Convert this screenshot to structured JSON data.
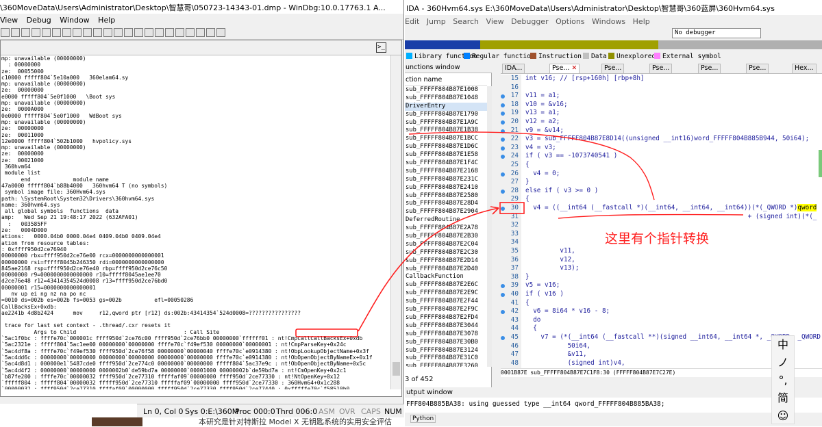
{
  "windbg": {
    "title": "\\360MoveData\\Users\\Administrator\\Desktop\\智慧哥\\050723-14343-01.dmp - WinDbg:10.0.17763.1 A...",
    "menu": [
      "View",
      "Debug",
      "Window",
      "Help"
    ],
    "cmd_icon": ">_",
    "lines": [
      "mp: unavailable (00000000)",
      "  : 00000000",
      "ze:  00055000",
      "c10000 fffff804`5e10a000   360elam64.sy",
      "mp: unavailable (00000000)",
      "ze:  00000000",
      "e0000 fffff804`5e0f1000   \\Boot sys",
      "mp: unavailable (00000000)",
      "ze:  0000A000",
      "0e0000 fffff804`5e0f1000   WdBoot sys",
      "mp: unavailable (00000000)",
      "ze:  00000000",
      "ze:  00011000",
      "12e0000 fffff804`502b1000   hvpolicy.sys",
      "mp: unavailable (00000000)",
      "ze:  00000000",
      "ze:  00021000",
      " 360hvm64",
      " module list",
      "      end             module name",
      "47a0000 fffff804`b88b4000   360hvm64 T (no symbols)",
      " symbol image file: 360Hvm64.sys",
      "path: \\SystemRoot\\System32\\Drivers\\360hvm64.sys",
      "name: 360hvm64.sys",
      " all global symbols  functions  data",
      "amp:   Wed Sep 21 19:48:17 2022 (632AFA01)",
      "  :   003585FF",
      "ze:   0004D000",
      "ations:   0000.04b0 0000.04e4 0409.04b0 0409.04e4",
      "ation from resource tables:",
      ": 0xffff950d2ce76940",
      "00000000 rbx=ffff950d2ce76e00 rcx=0000000000000001",
      "00000000 rsi=fffff8045b246350 rdi=0000000000000000",
      "845ae2168 rsp=ffff950d2ce76e40 rbp=ffff950d2ce76c50",
      "00000000 r9=0000000000000000 r10=fffff8045ae1ee70",
      "d2ce76e48 r12=43414354524d0008 r13=ffff950d2ce76bd0",
      "00000001 r15=0000000000000001",
      "   nv up ei ng nz na po nc",
      "=0010 ds=002b es=002b fs=0053 gs=002b          efl=00050286",
      "CallBacksEx+0xdb:",
      "ae2241b 4d8b2424      mov     r12,qword ptr [r12] ds:002b:43414354`524d0008=????????????????",
      "",
      " trace for last set context - .thread/.cxr resets it",
      "          Args to Child                                 : Call Site",
      "`5ac1f0bc : ffffe70c`000001c ffff950d`2ce76c00 ffff950d`2ce76bb0 00000000`ffffff01 : nt!CmpCallCallBacksEx+0xdb",
      "`5ac2321e : fffff804`5ac1ee00 00000000`00000000 ffffe70c`f49ef530 00000000`00000001 : nt!CmpParseKey+0x24c",
      "`5ac4df8a : ffffe70c`f49ef530 ffff950d`2ce76f58 00000000`00000040 ffffe70c`e0914380 : nt!ObpLookupObjectName+0x3f",
      "`5ac4dd6c : 00000000`00000000 00000000`00000000 00000000`00000000 ffffe70c`e0914380 : nt!ObOpenObjectByNameEx+0x1f",
      "`5ac4d8d1 : 000000e1`5487cde0 ffff950d`2ce774c0 00000000`00000000 fffff804`5ac37e9c : nt!ObOpenObjectByName+0x5c",
      "`5ac4d4f2 : 00000000`00000000 0000002b0`de59bd7a 00000000`00001000 00000002b`de59bd7a : nt!CmOpenKey+0x2c1",
      "`b87fe200 : ffffe70c`00000032 ffff950d`2ce77310 fffffaf09`00000000 ffff950d`2ce77330 : nt!NtOpenKey+0x12",
      "`fffff804 : fffff804`00000032 fffff950d`2ce77310 fffffaf09`00000000 ffff950d`2ce77330 : 360Hvm64+0x1c288",
      "`00000032 : ffff950d`2ce77310 ffffaf09`00000000 fffff950d`2ce77330 ffff950d`2ce77440 : 0xfffffe70c`f58510b0",
      "`2ce77310 : ffffaf09`00000000 ffff950d`2ce77330 ffff950d`2ce77440 000000e1`5487cde0 : 0xfffff804`00000032",
      "`00000000 : ffff950d`2ce77330 ffff950d`2ce77440 000000e1`5487cde0 00000000`00020019 : 0xffff950d`2ce77310",
      "`2ce77330 : ffff950d`2ce77440 000000e1`5487cde0 00000000`00020019 0xffffaf09`00000000",
      "`2ce77440 : 000000e1`5487cde0 00000000`00020019 fffff804`5a81731e 0xfffff950d`2ce77330",
      "`5487cde0 : 00000000`00020019 fffff804`5a81731e 00000000`00000000 0xffff950d`2ce77440",
      "`00020019 : fffff804`5a81731e 00000000`00000000 fffff804`b87e9031 0x000000e1`5487cde0",
      "`5487cde0 : fffff804`5a81731e 00000000`00000000 fffff804`b87e9031 00000000`00000000 : 0x20019"
    ]
  },
  "statusbar": {
    "ln": "Ln 0, Col 0",
    "sys": "Sys 0:E:\\360M",
    "proc": "Proc 000:0",
    "thrd": "Thrd 006:0",
    "asm": "ASM",
    "ovr": "OVR",
    "caps": "CAPS",
    "num": "NUM"
  },
  "bottom_text": "本研究是针对特斯拉 Model X 无钥匙系统的实用安全评估",
  "ida": {
    "title": "IDA - 360Hvm64.sys E:\\360MoveData\\Users\\Administrator\\Desktop\\智慧哥\\360蓝屏\\360Hvm64.sys",
    "menu": [
      "Edit",
      "Jump",
      "Search",
      "View",
      "Debugger",
      "Options",
      "Windows",
      "Help"
    ],
    "debugger": "No debugger",
    "legend": [
      {
        "label": "Library function",
        "color": "#00b0ff"
      },
      {
        "label": "Regular function",
        "color": "#0080ff"
      },
      {
        "label": "Instruction",
        "color": "#a0522d"
      },
      {
        "label": "Data",
        "color": "#c0c0c0"
      },
      {
        "label": "Unexplored",
        "color": "#909000"
      },
      {
        "label": "External symbol",
        "color": "#ff80ff"
      }
    ],
    "functions_header": "unctions window",
    "functions_col": "ction name",
    "functions": [
      "sub_FFFFF804B87E1008",
      "sub_FFFFF804B87E1048",
      "DriverEntry",
      "sub_FFFFF804B87E1790",
      "sub_FFFFF804B87E1A9C",
      "sub_FFFFF804B87E1B38",
      "sub_FFFFF804B87E1BCC",
      "sub_FFFFF804B87E1D6C",
      "sub_FFFFF804B87E1E58",
      "sub_FFFFF804B87E1F4C",
      "sub_FFFFF804B87E2168",
      "sub_FFFFF804B87E231C",
      "sub_FFFFF804B87E2410",
      "sub_FFFFF804B87E2580",
      "sub_FFFFF804B87E28D4",
      "sub_FFFFF804B87E2904",
      "DeferredRoutine",
      "sub_FFFFF804B87E2A78",
      "sub_FFFFF804B87E2B30",
      "sub_FFFFF804B87E2C04",
      "sub_FFFFF804B87E2C30",
      "sub_FFFFF804B87E2D14",
      "sub_FFFFF804B87E2D40",
      "CallbackFunction",
      "sub_FFFFF804B87E2E6C",
      "sub_FFFFF804B87E2E9C",
      "sub_FFFFF804B87E2F44",
      "sub_FFFFF804B87E2F9C",
      "sub_FFFFF804B87E2FD4",
      "sub_FFFFF804B87E3044",
      "sub_FFFFF804B87E3078",
      "sub_FFFFF804B87E30B0",
      "sub_FFFFF804B87E3124",
      "sub_FFFFF804B87E31C0",
      "sub_FFFFF804B87E3260"
    ],
    "functions_count": "3 of 452",
    "tabs": [
      "IDA...",
      "Pse...",
      "Pse...",
      "Pse...",
      "Pse...",
      "Pse...",
      "Hex..."
    ],
    "code": [
      {
        "n": "15",
        "t": "int v16; // [rsp+160h] [rbp+8h]",
        "bp": false
      },
      {
        "n": "16",
        "t": "",
        "bp": false
      },
      {
        "n": "17",
        "t": "v11 = a1;",
        "bp": true
      },
      {
        "n": "18",
        "t": "v10 = &v16;",
        "bp": true
      },
      {
        "n": "19",
        "t": "v13 = a1;",
        "bp": true
      },
      {
        "n": "20",
        "t": "v12 = a2;",
        "bp": true
      },
      {
        "n": "21",
        "t": "v9 = &v14;",
        "bp": true
      },
      {
        "n": "22",
        "t": "v3 = sub_FFFFF804B87E8D14((unsigned __int16)word_FFFFF804B885B944, 50i64);",
        "bp": true
      },
      {
        "n": "23",
        "t": "v4 = v3;",
        "bp": true
      },
      {
        "n": "24",
        "t": "if ( v3 == -1073740541 )",
        "bp": true
      },
      {
        "n": "25",
        "t": "{",
        "bp": false
      },
      {
        "n": "26",
        "t": "  v4 = 0;",
        "bp": true
      },
      {
        "n": "27",
        "t": "}",
        "bp": false
      },
      {
        "n": "28",
        "t": "else if ( v3 >= 0 )",
        "bp": true
      },
      {
        "n": "29",
        "t": "{",
        "bp": false
      },
      {
        "n": "30",
        "t": "  v4 = ((__int64 (__fastcall *)(__int64, __int64, __int64))(*(_QWORD *)",
        "hl": "qword",
        "bp": true
      },
      {
        "n": "31",
        "t": "                                                          + (signed int)(*(_",
        "bp": false
      },
      {
        "n": "32",
        "t": "",
        "bp": false
      },
      {
        "n": "33",
        "t": "",
        "bp": false
      },
      {
        "n": "34",
        "t": "",
        "bp": false
      },
      {
        "n": "35",
        "t": "         v11,",
        "bp": false
      },
      {
        "n": "36",
        "t": "         v12,",
        "bp": false
      },
      {
        "n": "37",
        "t": "         v13);",
        "bp": false
      },
      {
        "n": "38",
        "t": "}",
        "bp": false
      },
      {
        "n": "39",
        "t": "v5 = v16;",
        "bp": true
      },
      {
        "n": "40",
        "t": "if ( v16 )",
        "bp": true
      },
      {
        "n": "41",
        "t": "{",
        "bp": false
      },
      {
        "n": "42",
        "t": "  v6 = 8i64 * v16 - 8;",
        "bp": true
      },
      {
        "n": "43",
        "t": "  do",
        "bp": false
      },
      {
        "n": "44",
        "t": "  {",
        "bp": false
      },
      {
        "n": "45",
        "t": "    v7 = (*(__int64 (__fastcall **)(signed __int64, __int64 *, _QWORD, _QWORD",
        "bp": true
      },
      {
        "n": "46",
        "t": "           50i64,",
        "bp": false
      },
      {
        "n": "47",
        "t": "           &v11,",
        "bp": false
      },
      {
        "n": "48",
        "t": "           (signed int)v4,",
        "bp": false
      }
    ],
    "pseudo_status": "0001B87E sub_FFFFF804B87E7C1F8:30 (FFFFF804B87E7C27E)",
    "output_header": "utput window",
    "output_line": "FFF804B885BA38: using guessed type __int64 qword_FFFFF804B885BA38;",
    "python_btn": "Python"
  },
  "annotation": "这里有个指针转换",
  "ime": [
    "中",
    "ノ",
    "°,",
    "简",
    "☺"
  ]
}
